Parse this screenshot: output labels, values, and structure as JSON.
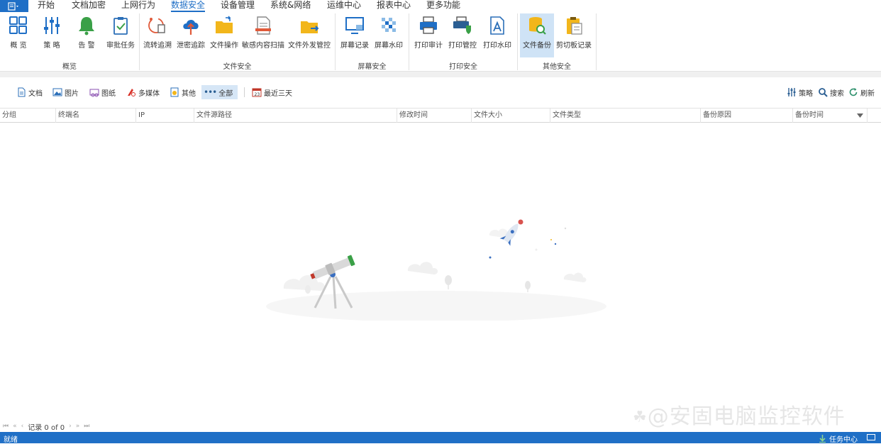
{
  "menubar": {
    "app_icon": "app-menu-icon",
    "tabs": [
      "开始",
      "文档加密",
      "上网行为",
      "数据安全",
      "设备管理",
      "系统&网络",
      "运维中心",
      "报表中心",
      "更多功能"
    ],
    "active_tab": "数据安全"
  },
  "ribbon": {
    "buttons": [
      "概 览",
      "策 略",
      "告 警",
      "审批任务",
      "流转追溯",
      "泄密追踪",
      "文件操作",
      "敏感内容扫描",
      "文件外发管控",
      "屏幕记录",
      "屏幕水印",
      "打印审计",
      "打印管控",
      "打印水印",
      "文件备份",
      "剪切板记录"
    ],
    "active_button": "文件备份",
    "groups": [
      "概览",
      "文件安全",
      "屏幕安全",
      "打印安全",
      "其他安全"
    ]
  },
  "filterbar": {
    "types": [
      "文档",
      "图片",
      "图纸",
      "多媒体",
      "其他",
      "全部"
    ],
    "active_type": "全部",
    "date_filter": "最近三天",
    "right_actions": [
      "策略",
      "搜索",
      "刷新"
    ]
  },
  "grid": {
    "columns": [
      "分组",
      "终端名",
      "IP",
      "文件源路径",
      "修改时间",
      "文件大小",
      "文件类型",
      "备份原因",
      "备份时间"
    ]
  },
  "pager": {
    "nav_first": "⏮",
    "nav_prev_page": "«",
    "nav_prev": "‹",
    "record_text": "记录 0 of 0",
    "nav_next": "›",
    "nav_next_page": "»",
    "nav_last": "⏭"
  },
  "statusbar": {
    "status": "就绪",
    "task_center": "任务中心"
  },
  "watermark": "@安固电脑监控软件",
  "colors": {
    "accent": "#1f6fc6",
    "active_bg": "#cfe3f6",
    "folder_yellow": "#f2b61b",
    "alert_green": "#3aa047",
    "status_bar": "#1f6fc6"
  }
}
